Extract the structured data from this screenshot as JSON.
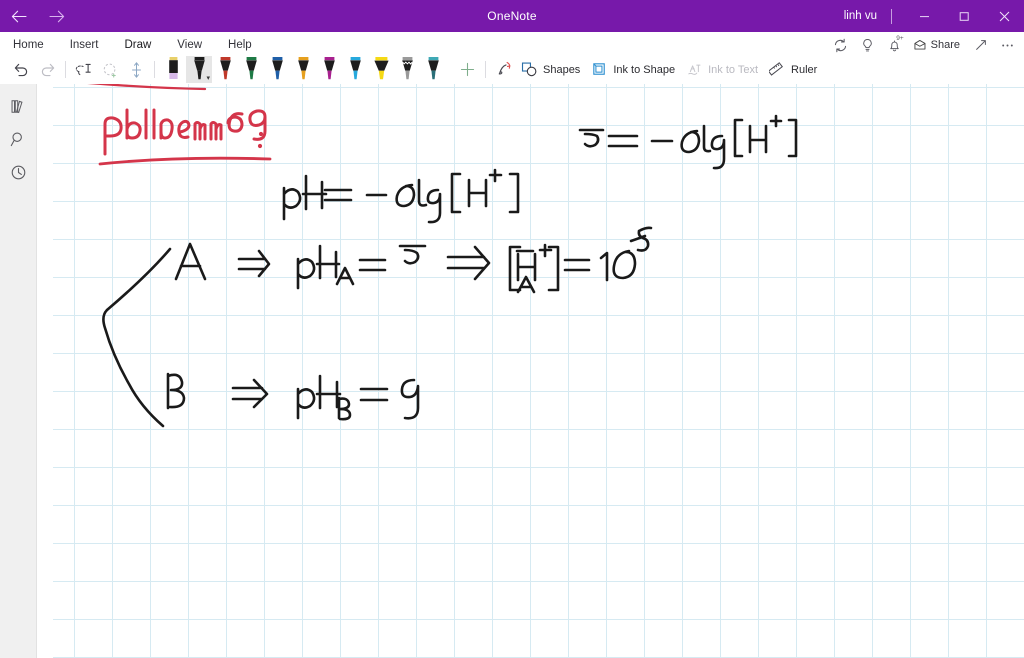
{
  "titlebar": {
    "app_title": "OneNote",
    "user_name": "linh vu",
    "back_icon": "back-arrow-icon",
    "forward_icon": "forward-arrow-icon",
    "minimize_label": "–",
    "restore_label": "❐",
    "close_label": "✕",
    "accent_color": "#7719aa"
  },
  "ribbon": {
    "tabs": [
      {
        "label": "Home",
        "active": false
      },
      {
        "label": "Insert",
        "active": false
      },
      {
        "label": "Draw",
        "active": true
      },
      {
        "label": "View",
        "active": false
      },
      {
        "label": "Help",
        "active": false
      }
    ],
    "right_actions": [
      {
        "name": "sync-icon",
        "label": ""
      },
      {
        "name": "lightbulb-icon",
        "label": ""
      },
      {
        "name": "notifications-bell-icon",
        "label": "",
        "badge": "9+"
      },
      {
        "name": "share-button",
        "label": "Share"
      },
      {
        "name": "expand-icon",
        "label": ""
      },
      {
        "name": "more-options-icon",
        "label": ""
      }
    ]
  },
  "toolstrip": {
    "undo_label": "Undo",
    "redo_label": "Redo",
    "lasso_label": "Lasso Select",
    "eraser_label": "Eraser",
    "insert_space_label": "Insert Space",
    "add_pen_label": "+",
    "pens": [
      {
        "name": "eraser-tool",
        "body": "#1d1d1d",
        "tip": "#d7b9e8",
        "cap": "#e8d06a",
        "type": "eraser",
        "selected": false
      },
      {
        "name": "pen-black",
        "body": "#1d1d1d",
        "tip": "#1d1d1d",
        "cap": "#1d1d1d",
        "type": "pen",
        "selected": true
      },
      {
        "name": "pen-red",
        "body": "#1d1d1d",
        "tip": "#c0392b",
        "cap": "#c0392b",
        "type": "pen",
        "selected": false
      },
      {
        "name": "pen-green",
        "body": "#1d1d1d",
        "tip": "#1e7a45",
        "cap": "#1e7a45",
        "type": "pen",
        "selected": false
      },
      {
        "name": "pen-blue",
        "body": "#1d1d1d",
        "tip": "#1f5fa8",
        "cap": "#1f5fa8",
        "type": "pen",
        "selected": false
      },
      {
        "name": "pen-orange",
        "body": "#1d1d1d",
        "tip": "#e6a01e",
        "cap": "#e6a01e",
        "type": "pen",
        "selected": false
      },
      {
        "name": "pen-magenta",
        "body": "#1d1d1d",
        "tip": "#a8208f",
        "cap": "#a8208f",
        "type": "pen",
        "selected": false
      },
      {
        "name": "pen-cyan",
        "body": "#1d1d1d",
        "tip": "#27a9dd",
        "cap": "#27a9dd",
        "type": "pen",
        "selected": false
      },
      {
        "name": "highlighter-yellow",
        "body": "#1d1d1d",
        "tip": "#f5d915",
        "cap": "#f5d915",
        "type": "highlighter",
        "selected": false
      },
      {
        "name": "pen-silver",
        "body": "#1d1d1d",
        "tip": "#9a9a9a",
        "cap": "#9a9a9a",
        "type": "galaxy",
        "selected": false
      },
      {
        "name": "pen-teal",
        "body": "#1d1d1d",
        "tip": "#2a6f78",
        "cap": "#3fa9b5",
        "type": "pen",
        "selected": false
      }
    ],
    "buttons": [
      {
        "name": "ink-replay-button",
        "label": ""
      },
      {
        "name": "shapes-button",
        "label": "Shapes",
        "disabled": false
      },
      {
        "name": "ink-to-shape-button",
        "label": "Ink to Shape",
        "disabled": false
      },
      {
        "name": "ink-to-text-button",
        "label": "Ink to Text",
        "disabled": true
      },
      {
        "name": "ruler-button",
        "label": "Ruler",
        "disabled": false
      }
    ]
  },
  "rail": {
    "items": [
      {
        "name": "notebooks-icon",
        "label": "Notebooks"
      },
      {
        "name": "search-icon",
        "label": "Search"
      },
      {
        "name": "recent-notes-icon",
        "label": "Recent Notes"
      }
    ]
  },
  "canvas": {
    "grid_color": "#d6eaf2",
    "grid_size_px": 38,
    "ink_notes": [
      {
        "name": "ink-stroke-toolbar-mark",
        "text": "",
        "color": "#d4354a"
      },
      {
        "name": "ink-heading-problem",
        "text": "Problem 69",
        "color": "#d4354a",
        "underlined": true
      },
      {
        "name": "ink-heading-colon",
        "text": ":",
        "color": "#d4354a"
      },
      {
        "name": "ink-equation-ph-value",
        "text": "5 = -Log [H+]",
        "color": "#1a1a1a"
      },
      {
        "name": "ink-equation-ph-definition",
        "text": "pH = -Log [H+]",
        "color": "#1a1a1a"
      },
      {
        "name": "ink-brace",
        "text": "{",
        "color": "#1a1a1a"
      },
      {
        "name": "ink-line-a",
        "text": "A  =>  pH_A = 5  =>  [H+_A] = 10^-5",
        "color": "#1a1a1a"
      },
      {
        "name": "ink-line-b",
        "text": "B  =>  pH_B = 9",
        "color": "#1a1a1a"
      }
    ]
  }
}
